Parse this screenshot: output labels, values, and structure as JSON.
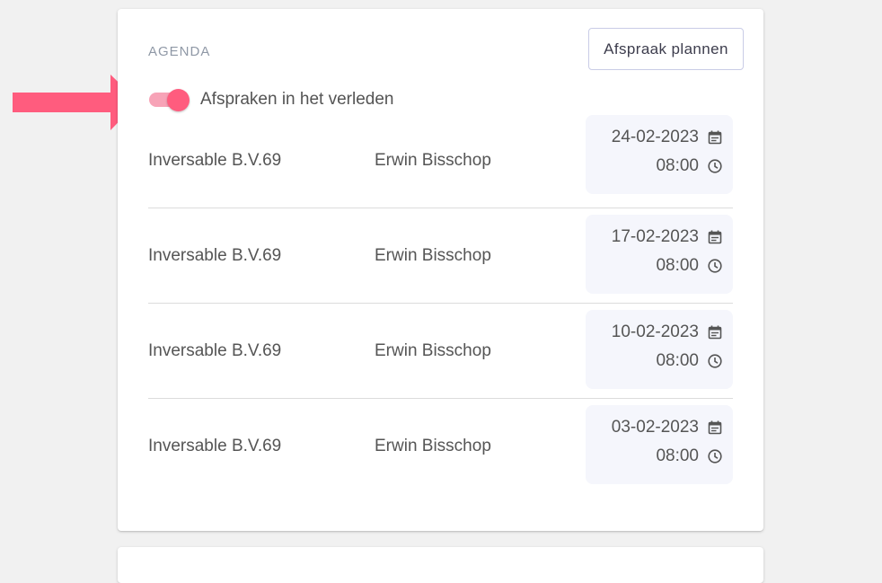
{
  "agenda": {
    "title": "AGENDA",
    "plan_button_label": "Afspraak plannen",
    "past_toggle": {
      "label": "Afspraken in het verleden",
      "checked": true
    },
    "appointments": [
      {
        "company": "Inversable B.V.69",
        "contact": "Erwin Bisschop",
        "date": "24-02-2023",
        "time": "08:00"
      },
      {
        "company": "Inversable B.V.69",
        "contact": "Erwin Bisschop",
        "date": "17-02-2023",
        "time": "08:00"
      },
      {
        "company": "Inversable B.V.69",
        "contact": "Erwin Bisschop",
        "date": "10-02-2023",
        "time": "08:00"
      },
      {
        "company": "Inversable B.V.69",
        "contact": "Erwin Bisschop",
        "date": "03-02-2023",
        "time": "08:00"
      }
    ]
  },
  "colors": {
    "accent": "#ff5c7e",
    "toggle_track": "#f7a3b7",
    "arrow": "#ff5c7e",
    "date_box_bg": "#f5f6fc"
  },
  "icons": {
    "date": "calendar-icon",
    "time": "clock-icon",
    "annotation": "arrow-right-icon"
  }
}
